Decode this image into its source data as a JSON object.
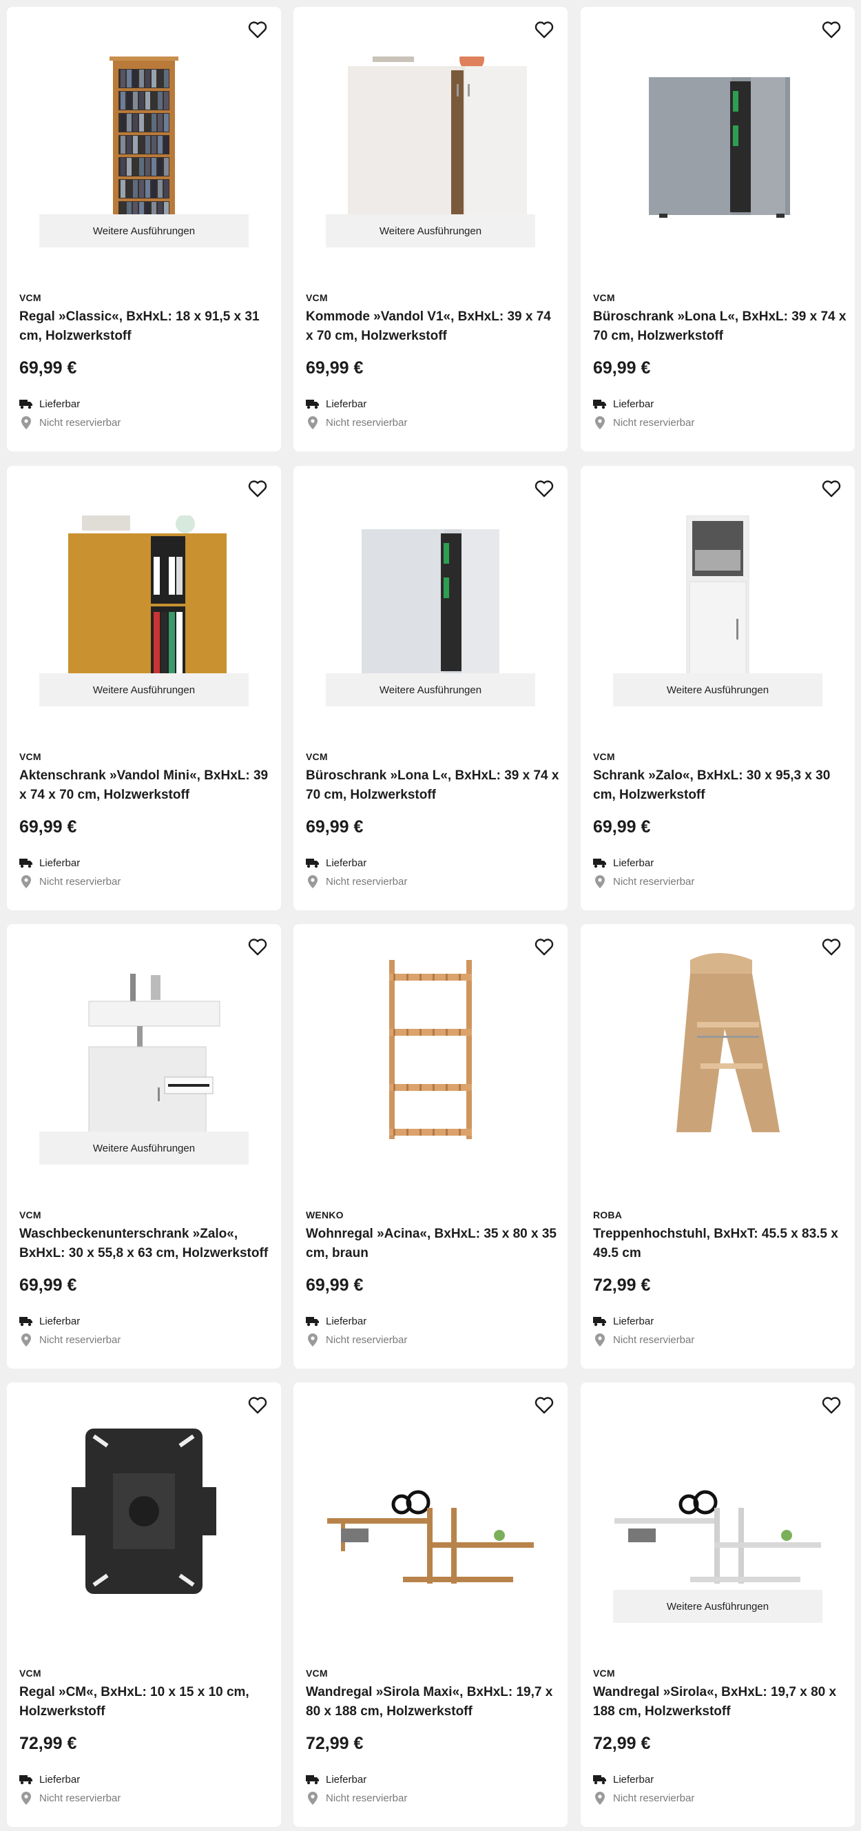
{
  "colors": {
    "text": "#1c1c1c",
    "muted": "#7a7a7a",
    "button_bg": "#f1f1f1",
    "page_bg": "#f0f0f0"
  },
  "products": [
    {
      "brand": "VCM",
      "title": "Regal »Classic«, BxHxL: 18 x 91,5 x 31 cm, Holzwerkstoff",
      "price": "69,99 €",
      "more_label": "Weitere Ausführungen",
      "delivery": "Lieferbar",
      "store": "Nicht reservierbar",
      "image": "narrow-dvd-shelf"
    },
    {
      "brand": "VCM",
      "title": "Kommode »Vandol V1«, BxHxL: 39 x 74 x 70 cm, Holzwerkstoff",
      "price": "69,99 €",
      "more_label": "Weitere Ausführungen",
      "delivery": "Lieferbar",
      "store": "Nicht reservierbar",
      "image": "white-dresser"
    },
    {
      "brand": "VCM",
      "title": "Büroschrank »Lona L«, BxHxL: 39 x 74 x 70 cm, Holzwerkstoff",
      "price": "69,99 €",
      "more_label": "",
      "delivery": "Lieferbar",
      "store": "Nicht reservierbar",
      "image": "grey-office-cabinet"
    },
    {
      "brand": "VCM",
      "title": "Aktenschrank »Vandol Mini«, BxHxL: 39 x 74 x 70 cm, Holzwerkstoff",
      "price": "69,99 €",
      "more_label": "Weitere Ausführungen",
      "delivery": "Lieferbar",
      "store": "Nicht reservierbar",
      "image": "beech-file-cabinet"
    },
    {
      "brand": "VCM",
      "title": "Büroschrank »Lona L«, BxHxL: 39 x 74 x 70 cm, Holzwerkstoff",
      "price": "69,99 €",
      "more_label": "Weitere Ausführungen",
      "delivery": "Lieferbar",
      "store": "Nicht reservierbar",
      "image": "white-office-cabinet"
    },
    {
      "brand": "VCM",
      "title": "Schrank »Zalo«, BxHxL: 30 x 95,3 x 30 cm, Holzwerkstoff",
      "price": "69,99 €",
      "more_label": "Weitere Ausführungen",
      "delivery": "Lieferbar",
      "store": "Nicht reservierbar",
      "image": "white-tall-cabinet"
    },
    {
      "brand": "VCM",
      "title": "Waschbeckenunterschrank »Zalo«, BxHxL: 30 x 55,8 x 63 cm, Holzwerkstoff",
      "price": "69,99 €",
      "more_label": "Weitere Ausführungen",
      "delivery": "Lieferbar",
      "store": "Nicht reservierbar",
      "image": "sink-cabinet"
    },
    {
      "brand": "WENKO",
      "title": "Wohnregal »Acina«, BxHxL: 35 x 80 x 35 cm, braun",
      "price": "69,99 €",
      "more_label": "",
      "delivery": "Lieferbar",
      "store": "Nicht reservierbar",
      "image": "bamboo-shelf"
    },
    {
      "brand": "ROBA",
      "title": "Treppenhochstuhl, BxHxT: 45.5 x 83.5 x 49.5 cm",
      "price": "72,99 €",
      "more_label": "",
      "delivery": "Lieferbar",
      "store": "Nicht reservierbar",
      "image": "high-chair"
    },
    {
      "brand": "VCM",
      "title": "Regal »CM«, BxHxL: 10 x 15 x 10 cm, Holzwerkstoff",
      "price": "72,99 €",
      "more_label": "",
      "delivery": "Lieferbar",
      "store": "Nicht reservierbar",
      "image": "black-tv-mount"
    },
    {
      "brand": "VCM",
      "title": "Wandregal »Sirola Maxi«, BxHxL: 19,7 x 80 x 188 cm, Holzwerkstoff",
      "price": "72,99 €",
      "more_label": "",
      "delivery": "Lieferbar",
      "store": "Nicht reservierbar",
      "image": "wall-shelf-wood"
    },
    {
      "brand": "VCM",
      "title": "Wandregal »Sirola«, BxHxL: 19,7 x 80 x 188 cm, Holzwerkstoff",
      "price": "72,99 €",
      "more_label": "Weitere Ausführungen",
      "delivery": "Lieferbar",
      "store": "Nicht reservierbar",
      "image": "wall-shelf-white"
    }
  ]
}
